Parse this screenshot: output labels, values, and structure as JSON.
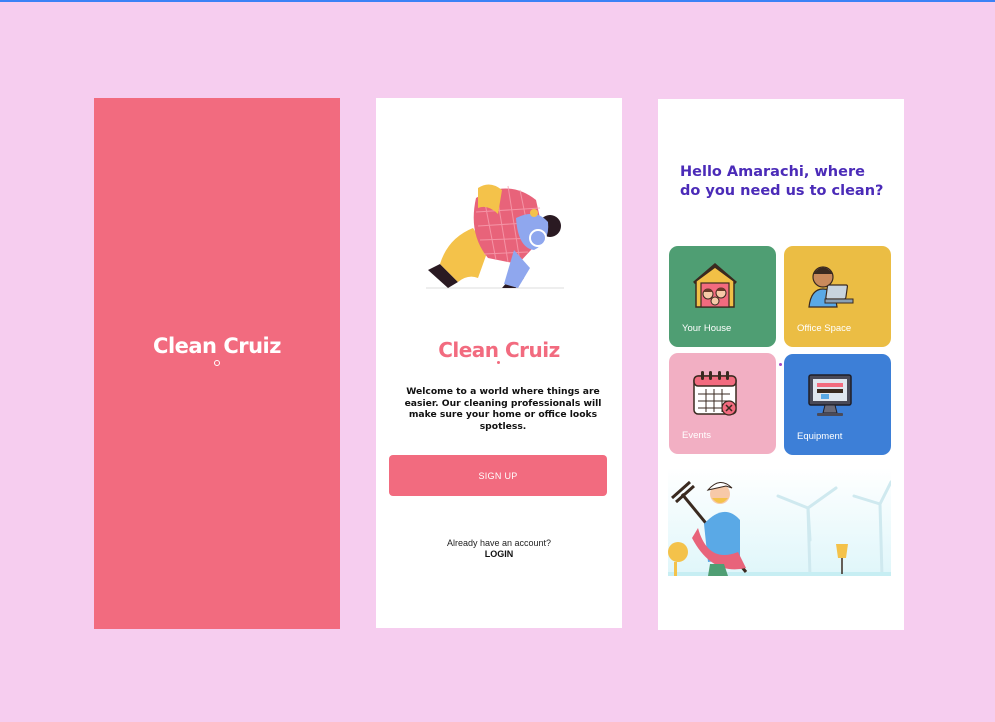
{
  "splash": {
    "logo": "Clean Cruiz"
  },
  "welcome": {
    "logo": "Clean Cruiz",
    "tagline": "Welcome to a world where things are easier. Our cleaning professionals will make sure your home or office looks spotless.",
    "signup_label": "SIGN UP",
    "account_prompt": "Already have an account?",
    "login_label": "LOGIN"
  },
  "home": {
    "greeting": "Hello Amarachi, where do you need us to clean?",
    "tiles": [
      {
        "label": "Your House",
        "icon": "house-family-icon",
        "color": "#4f9e73"
      },
      {
        "label": "Office Space",
        "icon": "office-worker-icon",
        "color": "#ebbd44"
      },
      {
        "label": "Events",
        "icon": "calendar-icon",
        "color": "#f2afc3"
      },
      {
        "label": "Equipment",
        "icon": "monitor-equipment-icon",
        "color": "#3d7fd7"
      }
    ]
  },
  "colors": {
    "background": "#f6cdef",
    "brand_pink": "#f26b7f",
    "greeting_purple": "#4b2bb8"
  }
}
